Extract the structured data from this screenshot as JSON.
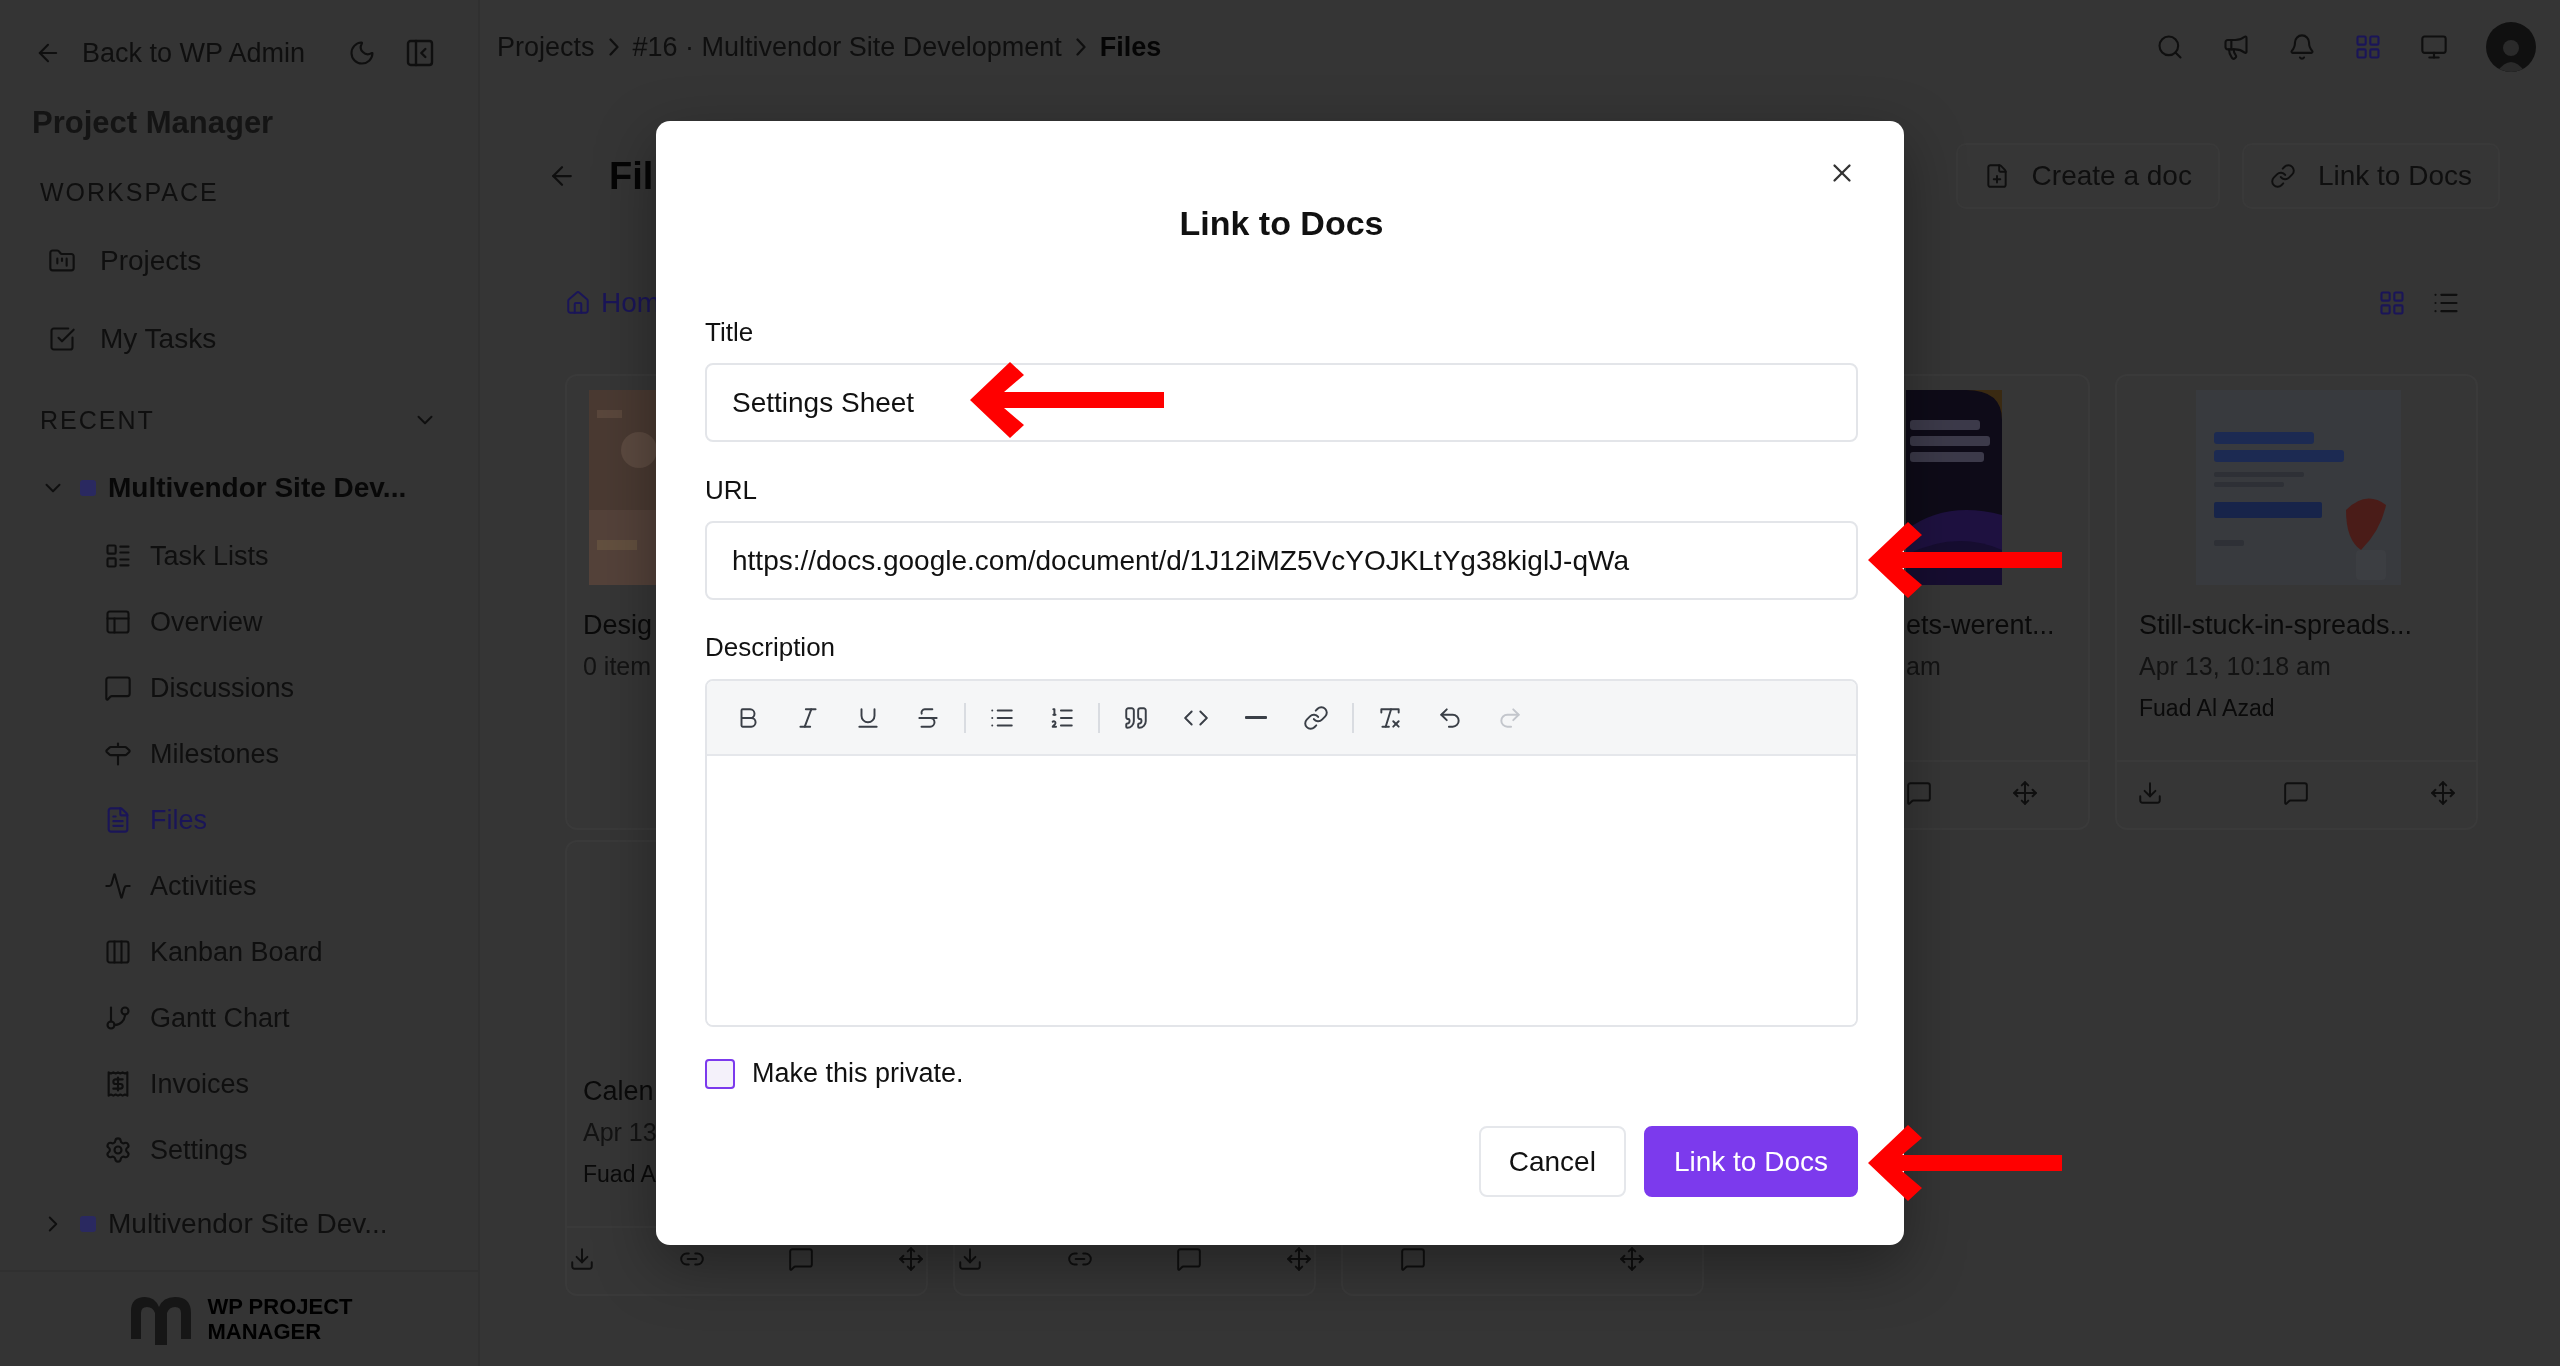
{
  "sidebar": {
    "back_link": "Back to WP Admin",
    "app_title": "Project Manager",
    "workspace": {
      "heading": "WORKSPACE",
      "items": [
        {
          "label": "Projects",
          "selected": false
        },
        {
          "label": "My Tasks",
          "selected": false
        }
      ]
    },
    "recent": {
      "heading": "RECENT",
      "expanded": true,
      "projects": [
        {
          "name": "Multivendor Site Dev...",
          "expanded": true,
          "children": [
            {
              "label": "Task Lists",
              "selected": false
            },
            {
              "label": "Overview",
              "selected": false
            },
            {
              "label": "Discussions",
              "selected": false
            },
            {
              "label": "Milestones",
              "selected": false
            },
            {
              "label": "Files",
              "selected": true
            },
            {
              "label": "Activities",
              "selected": false
            },
            {
              "label": "Kanban Board",
              "selected": false
            },
            {
              "label": "Gantt Chart",
              "selected": false
            },
            {
              "label": "Invoices",
              "selected": false
            },
            {
              "label": "Settings",
              "selected": false
            }
          ]
        },
        {
          "name": "Multivendor Site Dev...",
          "expanded": false
        }
      ]
    },
    "logo": {
      "line_1": "WP PROJECT",
      "line_2": "MANAGER"
    }
  },
  "top_bar": {
    "breadcrumb": [
      {
        "label": "Projects",
        "current": false
      },
      {
        "label": "#16 · Multivendor Site Development",
        "current": false
      },
      {
        "label": "Files",
        "current": true
      }
    ],
    "tools": [
      {
        "kind": "search",
        "selected": false
      },
      {
        "kind": "announcements",
        "selected": false
      },
      {
        "kind": "notifications",
        "selected": false
      },
      {
        "kind": "apps",
        "selected": true
      },
      {
        "kind": "screen",
        "selected": false
      }
    ]
  },
  "page": {
    "title": "Fil",
    "actions": [
      {
        "kind": "create",
        "label": "Create a doc"
      },
      {
        "kind": "link",
        "label": "Link to Docs"
      }
    ],
    "folder_path": "Hom",
    "view_modes": [
      {
        "kind": "grid",
        "selected": true
      },
      {
        "kind": "list",
        "selected": false
      }
    ],
    "card_rows": [
      [
        {
          "kind": "left-edge",
          "title": "Desig",
          "meta": "0 item",
          "thumbnail": true
        },
        {
          "kind": "right-edge",
          "title": "ets-werent...",
          "meta": "am",
          "thumbnail": true,
          "actions": [
            {
              "kind": "comment"
            },
            {
              "kind": "move"
            }
          ]
        },
        {
          "kind": "full",
          "title": "Still-stuck-in-spreads...",
          "meta": "Apr 13, 10:18 am",
          "author": "Fuad Al Azad",
          "thumbnail": true,
          "actions": [
            {
              "kind": "download"
            },
            {
              "kind": "comment"
            },
            {
              "kind": "move"
            }
          ]
        }
      ],
      [
        {
          "kind": "left-edge",
          "title": "Calen",
          "meta": "Apr 13",
          "author": "Fuad A",
          "thumbnail": false,
          "actions": [
            {
              "kind": "download"
            },
            {
              "kind": "link"
            },
            {
              "kind": "comment"
            },
            {
              "kind": "move"
            }
          ]
        },
        {
          "kind": "footer-only",
          "actions": [
            {
              "kind": "download"
            },
            {
              "kind": "link"
            },
            {
              "kind": "comment"
            },
            {
              "kind": "move"
            }
          ]
        },
        {
          "kind": "footer-only",
          "actions": [
            {
              "kind": "comment"
            },
            {
              "kind": "move"
            }
          ]
        }
      ]
    ]
  },
  "dialog": {
    "title": "Link to Docs",
    "fields": [
      {
        "label": "Title",
        "value": "Settings Sheet"
      },
      {
        "label": "URL",
        "value": "https://docs.google.com/document/d/1J12iMZ5VcYOJKLtYg38kiglJ-qWa"
      }
    ],
    "description": {
      "label": "Description",
      "toolbar_groups": [
        [
          {
            "kind": "bold",
            "disabled": false
          },
          {
            "kind": "italic",
            "disabled": false
          },
          {
            "kind": "underline",
            "disabled": false
          },
          {
            "kind": "strike",
            "disabled": false
          }
        ],
        [
          {
            "kind": "bullet-list",
            "disabled": false
          },
          {
            "kind": "ordered-list",
            "disabled": false
          }
        ],
        [
          {
            "kind": "quote",
            "disabled": false
          },
          {
            "kind": "code",
            "disabled": false
          },
          {
            "kind": "rule",
            "disabled": false
          },
          {
            "kind": "link",
            "disabled": false
          }
        ],
        [
          {
            "kind": "clear-format",
            "disabled": false
          },
          {
            "kind": "undo",
            "disabled": false
          },
          {
            "kind": "redo",
            "disabled": true
          }
        ]
      ]
    },
    "private": {
      "label": "Make this private.",
      "checked": false
    },
    "buttons": [
      {
        "kind": "secondary",
        "label": "Cancel"
      },
      {
        "kind": "primary",
        "label": "Link to Docs"
      }
    ]
  },
  "annotation_arrows": [
    {
      "kind": "arrow"
    },
    {
      "kind": "arrow"
    },
    {
      "kind": "arrow"
    }
  ]
}
